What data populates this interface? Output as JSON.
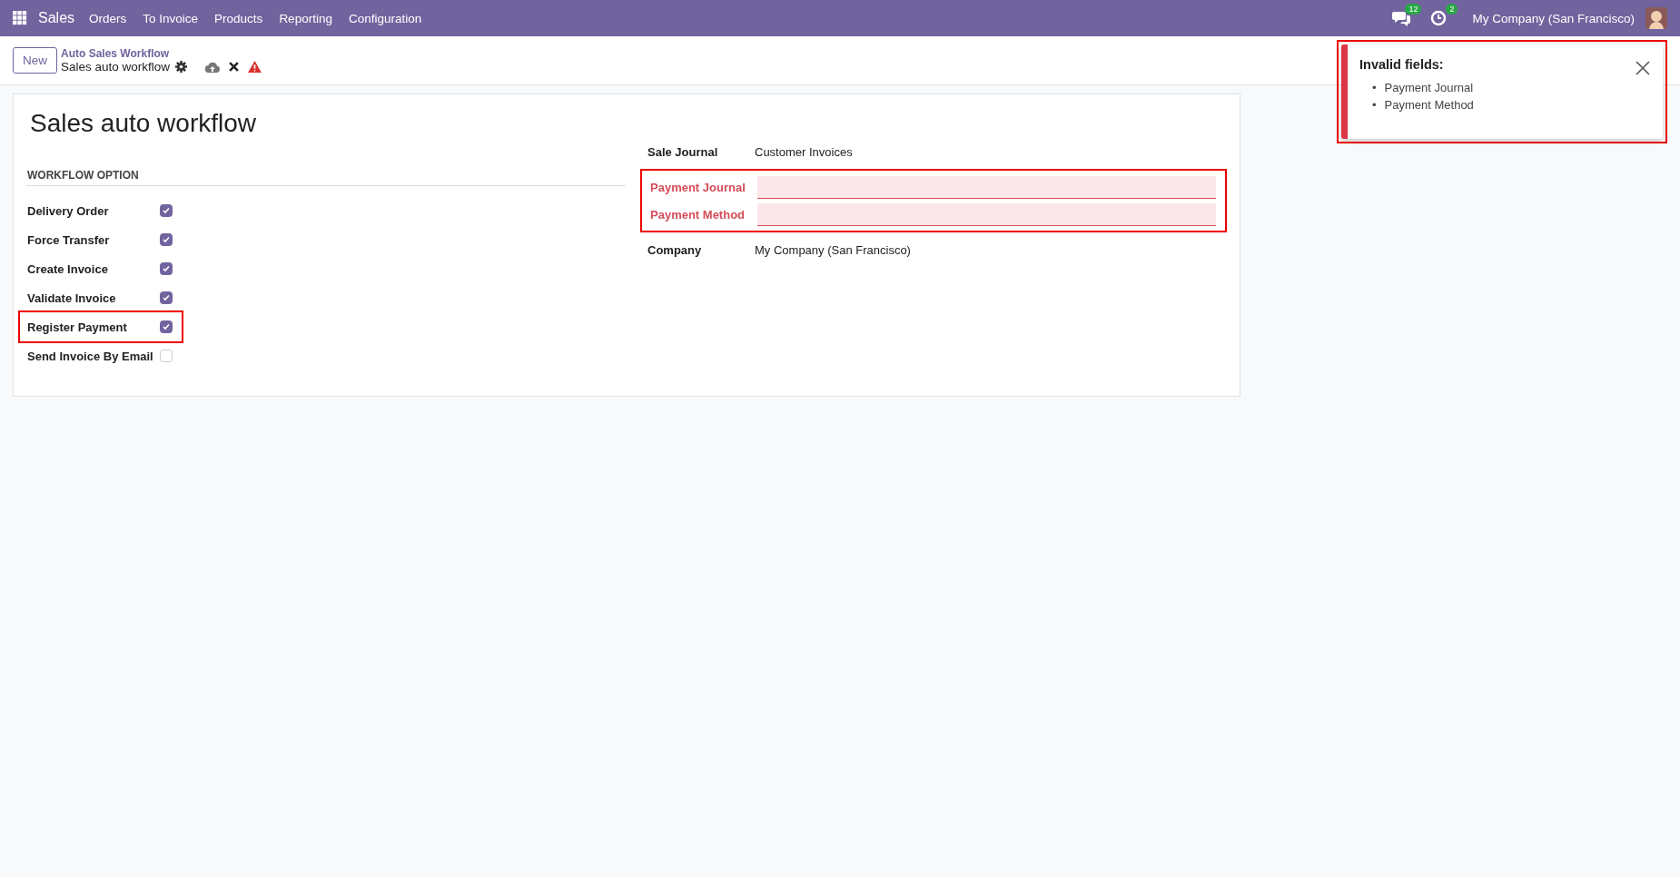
{
  "navbar": {
    "app": "Sales",
    "menu": [
      "Orders",
      "To Invoice",
      "Products",
      "Reporting",
      "Configuration"
    ],
    "messages_count": "12",
    "activities_count": "2",
    "company": "My Company (San Francisco)"
  },
  "control_panel": {
    "new_button": "New",
    "breadcrumb": "Auto Sales Workflow",
    "record": "Sales auto workflow"
  },
  "form": {
    "title": "Sales auto workflow",
    "section": "WORKFLOW OPTION",
    "options": [
      {
        "label": "Delivery Order",
        "checked": true,
        "highlighted": false
      },
      {
        "label": "Force Transfer",
        "checked": true,
        "highlighted": false
      },
      {
        "label": "Create Invoice",
        "checked": true,
        "highlighted": false
      },
      {
        "label": "Validate Invoice",
        "checked": true,
        "highlighted": false
      },
      {
        "label": "Register Payment",
        "checked": true,
        "highlighted": true
      },
      {
        "label": "Send Invoice By Email",
        "checked": false,
        "highlighted": false
      }
    ],
    "field_groups": [
      {
        "highlighted": false,
        "fields": [
          {
            "label": "Sale Journal",
            "value": "Customer Invoices",
            "invalid": false
          }
        ]
      },
      {
        "highlighted": true,
        "fields": [
          {
            "label": "Payment Journal",
            "invalid": true
          },
          {
            "label": "Payment Method",
            "invalid": true
          }
        ]
      },
      {
        "highlighted": false,
        "fields": [
          {
            "label": "Company",
            "value": "My Company (San Francisco)",
            "invalid": false
          }
        ]
      }
    ]
  },
  "toast": {
    "title": "Invalid fields:",
    "items": [
      {
        "bullet": "•",
        "text": "Payment Journal"
      },
      {
        "bullet": "•",
        "text": "Payment Method"
      }
    ],
    "highlighted": true
  }
}
